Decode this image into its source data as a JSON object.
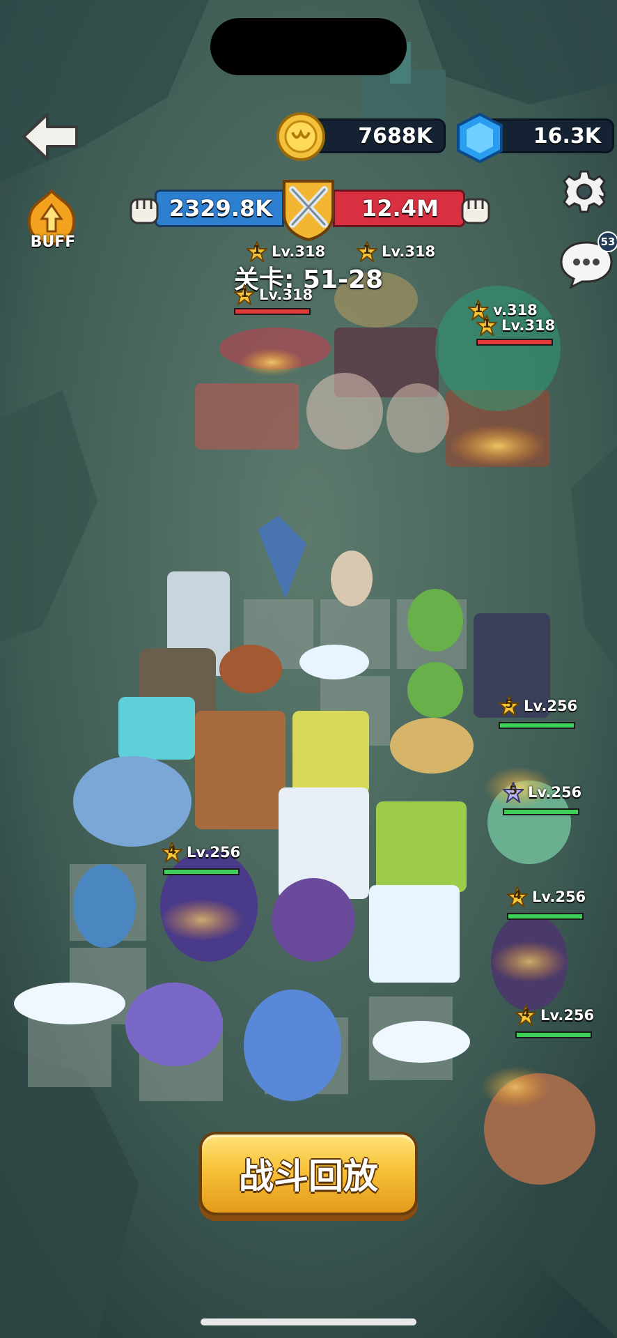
{
  "resources": {
    "gold": "7688K",
    "gems": "16.3K"
  },
  "buff": {
    "label": "BUFF"
  },
  "battle": {
    "player_power": "2329.8K",
    "enemy_power": "12.4M",
    "stage": "关卡: 51-28"
  },
  "chat": {
    "badge": "53"
  },
  "enemy_tags": [
    {
      "star": "1",
      "level": "Lv.318"
    },
    {
      "star": "1",
      "level": "Lv.318"
    },
    {
      "star": "1",
      "level": "Lv.318"
    },
    {
      "star": "1",
      "level": "v.318"
    },
    {
      "star": "1",
      "level": "Lv.318"
    }
  ],
  "player_tags": [
    {
      "star": "5",
      "level": "Lv.256"
    },
    {
      "star": "5",
      "level": "Lv.256"
    },
    {
      "star": "4",
      "level": "Lv.256"
    },
    {
      "star": "4",
      "level": "Lv.256"
    },
    {
      "star": "4",
      "level": "Lv.256"
    }
  ],
  "replay_button": {
    "label": "战斗回放"
  },
  "colors": {
    "player_bar": "#2d7fd0",
    "enemy_bar": "#d83040",
    "button": "#f7c238",
    "hp_green": "#3ed15a",
    "hp_red": "#e23a3a"
  }
}
